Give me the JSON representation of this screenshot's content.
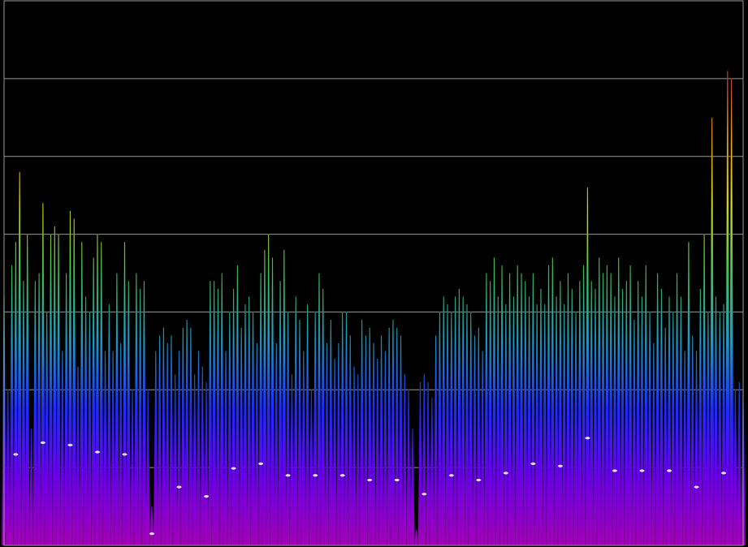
{
  "chart_data": {
    "type": "area",
    "title": "",
    "xlabel": "",
    "ylabel": "",
    "grid": true,
    "legend": "none",
    "ylim": [
      0,
      7
    ],
    "x_range": [
      0,
      190
    ],
    "colors": {
      "background": "#000000",
      "grid": "#9a9a9a",
      "gradient_stops": [
        "#a400b8",
        "#6a00e6",
        "#1f2bff",
        "#1c9bc8",
        "#3ec85a",
        "#d9dc14",
        "#f0a314",
        "#e43a3a",
        "#d4006e"
      ]
    },
    "peaks": [
      {
        "x": 0,
        "y": 3.2
      },
      {
        "x": 1,
        "y": 2.0
      },
      {
        "x": 2,
        "y": 3.6
      },
      {
        "x": 3,
        "y": 3.9
      },
      {
        "x": 4,
        "y": 4.8
      },
      {
        "x": 5,
        "y": 3.4
      },
      {
        "x": 6,
        "y": 4.0
      },
      {
        "x": 7,
        "y": 1.5
      },
      {
        "x": 8,
        "y": 3.4
      },
      {
        "x": 9,
        "y": 3.5
      },
      {
        "x": 10,
        "y": 4.4
      },
      {
        "x": 11,
        "y": 3.0
      },
      {
        "x": 12,
        "y": 4.0
      },
      {
        "x": 13,
        "y": 4.1
      },
      {
        "x": 14,
        "y": 4.0
      },
      {
        "x": 15,
        "y": 2.5
      },
      {
        "x": 16,
        "y": 3.5
      },
      {
        "x": 17,
        "y": 4.3
      },
      {
        "x": 18,
        "y": 4.2
      },
      {
        "x": 19,
        "y": 2.3
      },
      {
        "x": 20,
        "y": 3.9
      },
      {
        "x": 21,
        "y": 3.2
      },
      {
        "x": 22,
        "y": 3.0
      },
      {
        "x": 23,
        "y": 3.7
      },
      {
        "x": 24,
        "y": 4.0
      },
      {
        "x": 25,
        "y": 3.9
      },
      {
        "x": 26,
        "y": 2.5
      },
      {
        "x": 27,
        "y": 3.1
      },
      {
        "x": 28,
        "y": 2.5
      },
      {
        "x": 29,
        "y": 3.5
      },
      {
        "x": 30,
        "y": 2.6
      },
      {
        "x": 31,
        "y": 3.9
      },
      {
        "x": 32,
        "y": 3.4
      },
      {
        "x": 33,
        "y": 2.0
      },
      {
        "x": 34,
        "y": 3.5
      },
      {
        "x": 35,
        "y": 3.3
      },
      {
        "x": 36,
        "y": 3.4
      },
      {
        "x": 37,
        "y": 2.0
      },
      {
        "x": 38,
        "y": 0.5
      },
      {
        "x": 39,
        "y": 2.5
      },
      {
        "x": 40,
        "y": 2.7
      },
      {
        "x": 41,
        "y": 2.8
      },
      {
        "x": 42,
        "y": 2.6
      },
      {
        "x": 43,
        "y": 2.7
      },
      {
        "x": 44,
        "y": 2.2
      },
      {
        "x": 45,
        "y": 2.5
      },
      {
        "x": 46,
        "y": 2.8
      },
      {
        "x": 47,
        "y": 2.9
      },
      {
        "x": 48,
        "y": 2.8
      },
      {
        "x": 49,
        "y": 2.2
      },
      {
        "x": 50,
        "y": 2.5
      },
      {
        "x": 51,
        "y": 2.3
      },
      {
        "x": 52,
        "y": 2.1
      },
      {
        "x": 53,
        "y": 3.4
      },
      {
        "x": 54,
        "y": 3.4
      },
      {
        "x": 55,
        "y": 3.3
      },
      {
        "x": 56,
        "y": 3.5
      },
      {
        "x": 57,
        "y": 2.5
      },
      {
        "x": 58,
        "y": 3.0
      },
      {
        "x": 59,
        "y": 3.3
      },
      {
        "x": 60,
        "y": 3.6
      },
      {
        "x": 61,
        "y": 2.8
      },
      {
        "x": 62,
        "y": 3.1
      },
      {
        "x": 63,
        "y": 3.2
      },
      {
        "x": 64,
        "y": 3.0
      },
      {
        "x": 65,
        "y": 2.6
      },
      {
        "x": 66,
        "y": 3.5
      },
      {
        "x": 67,
        "y": 3.8
      },
      {
        "x": 68,
        "y": 4.0
      },
      {
        "x": 69,
        "y": 3.7
      },
      {
        "x": 70,
        "y": 2.6
      },
      {
        "x": 71,
        "y": 3.4
      },
      {
        "x": 72,
        "y": 3.8
      },
      {
        "x": 73,
        "y": 3.0
      },
      {
        "x": 74,
        "y": 2.2
      },
      {
        "x": 75,
        "y": 3.2
      },
      {
        "x": 76,
        "y": 2.9
      },
      {
        "x": 77,
        "y": 2.5
      },
      {
        "x": 78,
        "y": 3.1
      },
      {
        "x": 79,
        "y": 2.0
      },
      {
        "x": 80,
        "y": 3.0
      },
      {
        "x": 81,
        "y": 3.5
      },
      {
        "x": 82,
        "y": 3.3
      },
      {
        "x": 83,
        "y": 2.6
      },
      {
        "x": 84,
        "y": 2.9
      },
      {
        "x": 85,
        "y": 2.4
      },
      {
        "x": 86,
        "y": 2.6
      },
      {
        "x": 87,
        "y": 3.0
      },
      {
        "x": 88,
        "y": 3.0
      },
      {
        "x": 89,
        "y": 2.7
      },
      {
        "x": 90,
        "y": 2.3
      },
      {
        "x": 91,
        "y": 2.2
      },
      {
        "x": 92,
        "y": 2.9
      },
      {
        "x": 93,
        "y": 2.7
      },
      {
        "x": 94,
        "y": 2.8
      },
      {
        "x": 95,
        "y": 2.6
      },
      {
        "x": 96,
        "y": 2.4
      },
      {
        "x": 97,
        "y": 2.7
      },
      {
        "x": 98,
        "y": 2.5
      },
      {
        "x": 99,
        "y": 2.8
      },
      {
        "x": 100,
        "y": 2.9
      },
      {
        "x": 101,
        "y": 2.8
      },
      {
        "x": 102,
        "y": 2.7
      },
      {
        "x": 103,
        "y": 2.2
      },
      {
        "x": 104,
        "y": 2.0
      },
      {
        "x": 105,
        "y": 1.5
      },
      {
        "x": 106,
        "y": 0.2
      },
      {
        "x": 107,
        "y": 2.1
      },
      {
        "x": 108,
        "y": 2.2
      },
      {
        "x": 109,
        "y": 2.1
      },
      {
        "x": 110,
        "y": 1.9
      },
      {
        "x": 111,
        "y": 2.7
      },
      {
        "x": 112,
        "y": 3.0
      },
      {
        "x": 113,
        "y": 3.2
      },
      {
        "x": 114,
        "y": 3.1
      },
      {
        "x": 115,
        "y": 3.0
      },
      {
        "x": 116,
        "y": 3.2
      },
      {
        "x": 117,
        "y": 3.3
      },
      {
        "x": 118,
        "y": 3.2
      },
      {
        "x": 119,
        "y": 3.1
      },
      {
        "x": 120,
        "y": 3.0
      },
      {
        "x": 121,
        "y": 2.7
      },
      {
        "x": 122,
        "y": 2.8
      },
      {
        "x": 123,
        "y": 2.5
      },
      {
        "x": 124,
        "y": 3.5
      },
      {
        "x": 125,
        "y": 3.4
      },
      {
        "x": 126,
        "y": 3.7
      },
      {
        "x": 127,
        "y": 3.2
      },
      {
        "x": 128,
        "y": 3.6
      },
      {
        "x": 129,
        "y": 3.1
      },
      {
        "x": 130,
        "y": 3.5
      },
      {
        "x": 131,
        "y": 3.2
      },
      {
        "x": 132,
        "y": 3.6
      },
      {
        "x": 133,
        "y": 3.5
      },
      {
        "x": 134,
        "y": 3.4
      },
      {
        "x": 135,
        "y": 3.2
      },
      {
        "x": 136,
        "y": 3.5
      },
      {
        "x": 137,
        "y": 3.1
      },
      {
        "x": 138,
        "y": 3.3
      },
      {
        "x": 139,
        "y": 3.1
      },
      {
        "x": 140,
        "y": 3.6
      },
      {
        "x": 141,
        "y": 3.7
      },
      {
        "x": 142,
        "y": 3.2
      },
      {
        "x": 143,
        "y": 3.4
      },
      {
        "x": 144,
        "y": 3.1
      },
      {
        "x": 145,
        "y": 3.5
      },
      {
        "x": 146,
        "y": 3.3
      },
      {
        "x": 147,
        "y": 3.0
      },
      {
        "x": 148,
        "y": 3.4
      },
      {
        "x": 149,
        "y": 3.6
      },
      {
        "x": 150,
        "y": 4.6
      },
      {
        "x": 151,
        "y": 3.4
      },
      {
        "x": 152,
        "y": 3.3
      },
      {
        "x": 153,
        "y": 3.7
      },
      {
        "x": 154,
        "y": 3.5
      },
      {
        "x": 155,
        "y": 3.6
      },
      {
        "x": 156,
        "y": 3.5
      },
      {
        "x": 157,
        "y": 3.2
      },
      {
        "x": 158,
        "y": 3.7
      },
      {
        "x": 159,
        "y": 3.3
      },
      {
        "x": 160,
        "y": 3.4
      },
      {
        "x": 161,
        "y": 3.6
      },
      {
        "x": 162,
        "y": 2.9
      },
      {
        "x": 163,
        "y": 3.4
      },
      {
        "x": 164,
        "y": 3.2
      },
      {
        "x": 165,
        "y": 3.6
      },
      {
        "x": 166,
        "y": 3.0
      },
      {
        "x": 167,
        "y": 2.6
      },
      {
        "x": 168,
        "y": 3.5
      },
      {
        "x": 169,
        "y": 3.3
      },
      {
        "x": 170,
        "y": 2.8
      },
      {
        "x": 171,
        "y": 3.2
      },
      {
        "x": 172,
        "y": 3.0
      },
      {
        "x": 173,
        "y": 3.5
      },
      {
        "x": 174,
        "y": 3.2
      },
      {
        "x": 175,
        "y": 2.5
      },
      {
        "x": 176,
        "y": 3.9
      },
      {
        "x": 177,
        "y": 2.7
      },
      {
        "x": 178,
        "y": 2.5
      },
      {
        "x": 179,
        "y": 3.3
      },
      {
        "x": 180,
        "y": 4.0
      },
      {
        "x": 181,
        "y": 3.0
      },
      {
        "x": 182,
        "y": 5.5
      },
      {
        "x": 183,
        "y": 3.2
      },
      {
        "x": 184,
        "y": 3.0
      },
      {
        "x": 185,
        "y": 3.1
      },
      {
        "x": 186,
        "y": 6.1
      },
      {
        "x": 187,
        "y": 6.0
      },
      {
        "x": 188,
        "y": 2.0
      },
      {
        "x": 189,
        "y": 2.1
      },
      {
        "x": 190,
        "y": 2.0
      }
    ]
  }
}
